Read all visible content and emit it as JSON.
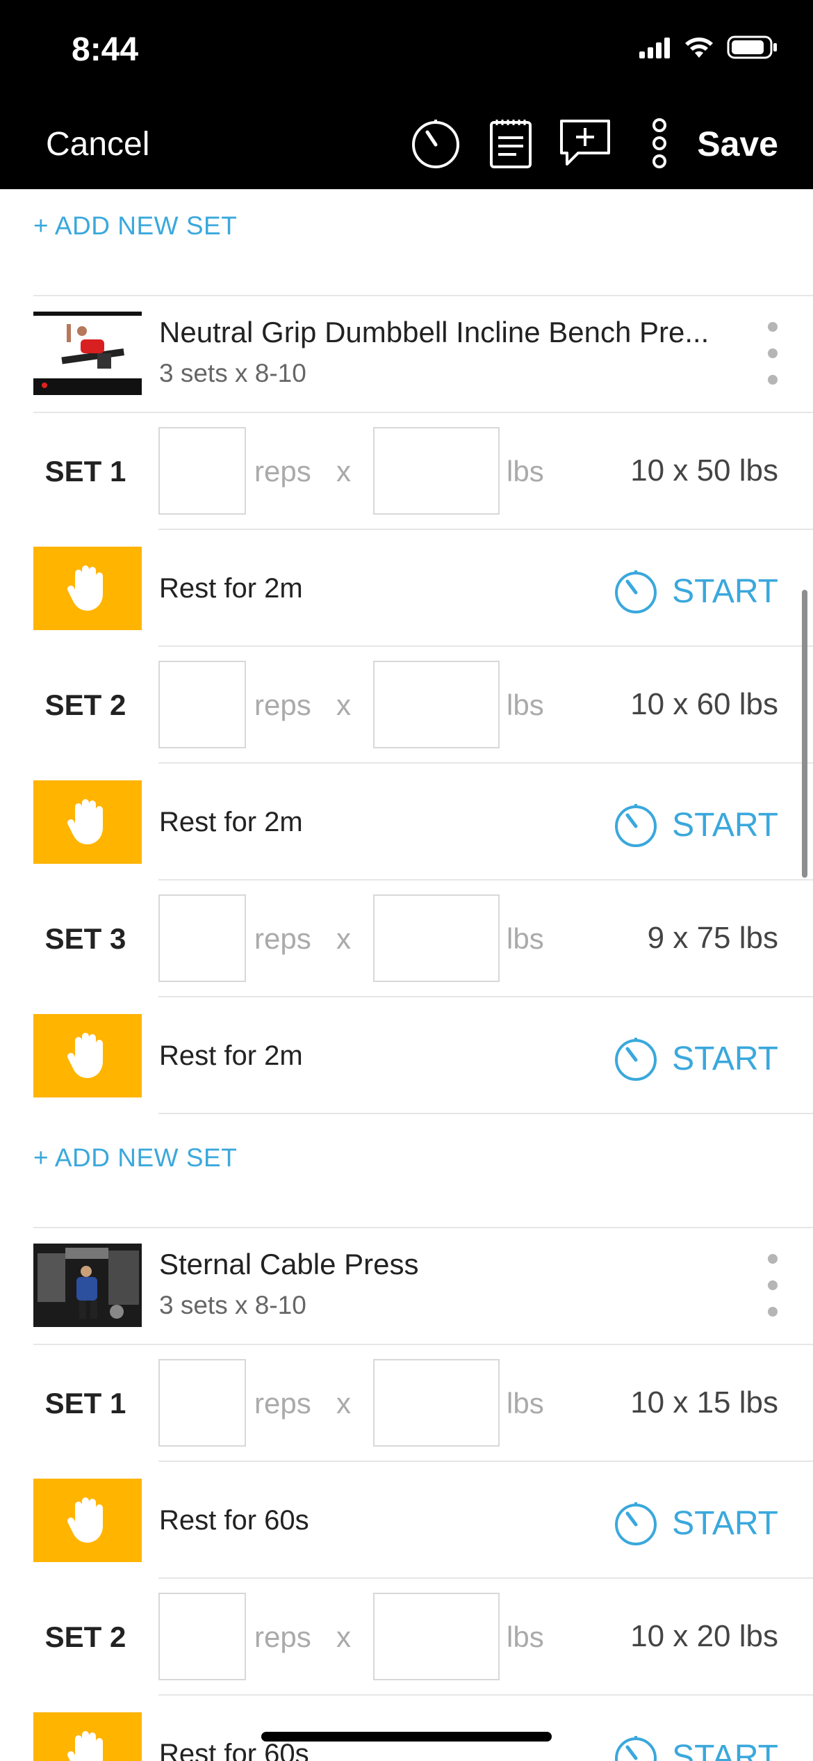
{
  "status_bar": {
    "time": "8:44"
  },
  "toolbar": {
    "cancel_label": "Cancel",
    "save_label": "Save",
    "icons": [
      "timer-icon",
      "notes-icon",
      "add-comment-icon",
      "more-icon"
    ]
  },
  "add_new_set_label": "+ ADD NEW SET",
  "exercises": [
    {
      "title": "Neutral Grip Dumbbell Incline Bench Pre...",
      "meta": "3 sets x 8-10",
      "rows": [
        {
          "type": "set",
          "label": "SET 1",
          "reps_placeholder": "reps",
          "x": "x",
          "lbs_placeholder": "lbs",
          "previous": "10 x 50 lbs"
        },
        {
          "type": "rest",
          "label": "Rest for 2m",
          "start": "START"
        },
        {
          "type": "set",
          "label": "SET 2",
          "reps_placeholder": "reps",
          "x": "x",
          "lbs_placeholder": "lbs",
          "previous": "10 x 60 lbs"
        },
        {
          "type": "rest",
          "label": "Rest for 2m",
          "start": "START"
        },
        {
          "type": "set",
          "label": "SET 3",
          "reps_placeholder": "reps",
          "x": "x",
          "lbs_placeholder": "lbs",
          "previous": "9 x 75 lbs"
        },
        {
          "type": "rest",
          "label": "Rest for 2m",
          "start": "START"
        }
      ]
    },
    {
      "title": "Sternal Cable Press",
      "meta": "3 sets x 8-10",
      "rows": [
        {
          "type": "set",
          "label": "SET 1",
          "reps_placeholder": "reps",
          "x": "x",
          "lbs_placeholder": "lbs",
          "previous": "10 x 15 lbs"
        },
        {
          "type": "rest",
          "label": "Rest for 60s",
          "start": "START"
        },
        {
          "type": "set",
          "label": "SET 2",
          "reps_placeholder": "reps",
          "x": "x",
          "lbs_placeholder": "lbs",
          "previous": "10 x 20 lbs"
        },
        {
          "type": "rest",
          "label": "Rest for 60s",
          "start": "START"
        }
      ]
    }
  ],
  "colors": {
    "accent": "#3aa8dc",
    "rest": "#ffb400",
    "header": "#000000"
  }
}
